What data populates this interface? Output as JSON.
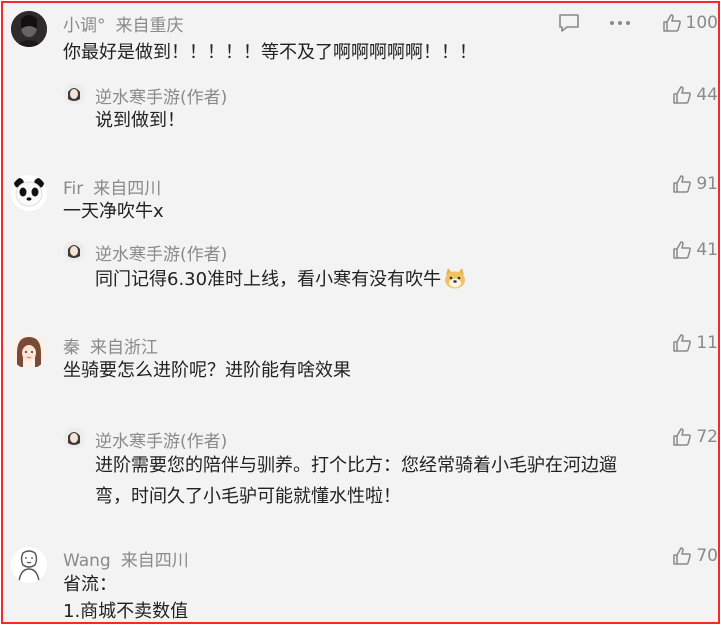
{
  "comments": [
    {
      "user": "小调°",
      "location": "来自重庆",
      "likes": "100",
      "text": "你最好是做到！！！！！等不及了啊啊啊啊啊！！！",
      "avatar_icon": "dark-portrait-avatar",
      "reply": {
        "user": "逆水寒手游(作者)",
        "likes": "44",
        "text": "说到做到！"
      }
    },
    {
      "user": "Fir",
      "location": "来自四川",
      "likes": "91",
      "text": "一天净吹牛x",
      "avatar_icon": "panda-avatar",
      "reply": {
        "user": "逆水寒手游(作者)",
        "likes": "41",
        "text": "同门记得6.30准时上线，看小寒有没有吹牛",
        "emoji": "doge-emoji"
      }
    },
    {
      "user": "秦",
      "location": "来自浙江",
      "likes": "11",
      "text": "坐骑要怎么进阶呢？进阶能有啥效果",
      "avatar_icon": "girl-cartoon-avatar",
      "reply": {
        "user": "逆水寒手游(作者)",
        "likes": "72",
        "text_lines": [
          "进阶需要您的陪伴与驯养。打个比方：您经常骑着小毛驴在河边遛",
          "弯，时间久了小毛驴可能就懂水性啦！"
        ]
      }
    },
    {
      "user": "Wang",
      "location": "来自四川",
      "likes": "70",
      "text_lines": [
        "省流：",
        "1.商城不卖数值"
      ],
      "avatar_icon": "sketch-avatar"
    }
  ],
  "colors": {
    "border": "#f42a2a",
    "background": "#f3f3f3",
    "meta": "#8a8a8a",
    "text": "#222222"
  }
}
